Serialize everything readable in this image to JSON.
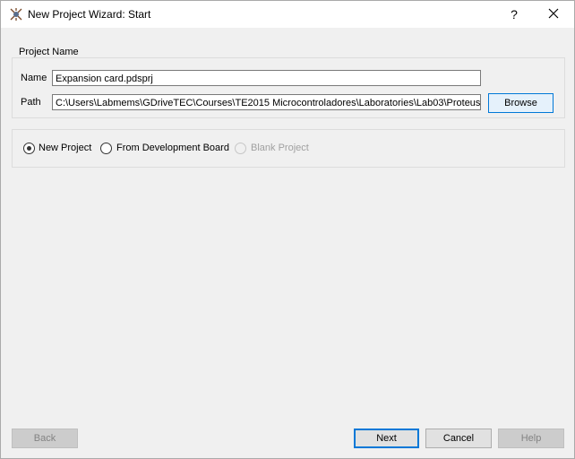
{
  "window": {
    "title": "New Project Wizard: Start",
    "help_glyph": "?"
  },
  "project_group": {
    "legend": "Project Name",
    "name_label": "Name",
    "name_value": "Expansion card.pdsprj",
    "path_label": "Path",
    "path_value": "C:\\Users\\Labmems\\GDriveTEC\\Courses\\TE2015 Microcontroladores\\Laboratories\\Lab03\\Proteus",
    "browse_label": "Browse"
  },
  "project_type": {
    "options": [
      {
        "label": "New Project",
        "checked": true,
        "enabled": true
      },
      {
        "label": "From Development Board",
        "checked": false,
        "enabled": true
      },
      {
        "label": "Blank Project",
        "checked": false,
        "enabled": false
      }
    ]
  },
  "footer": {
    "back_label": "Back",
    "next_label": "Next",
    "cancel_label": "Cancel",
    "help_label": "Help"
  },
  "colors": {
    "accent": "#0078d7",
    "window_bg": "#f0f0f0",
    "titlebar_bg": "#ffffff"
  }
}
